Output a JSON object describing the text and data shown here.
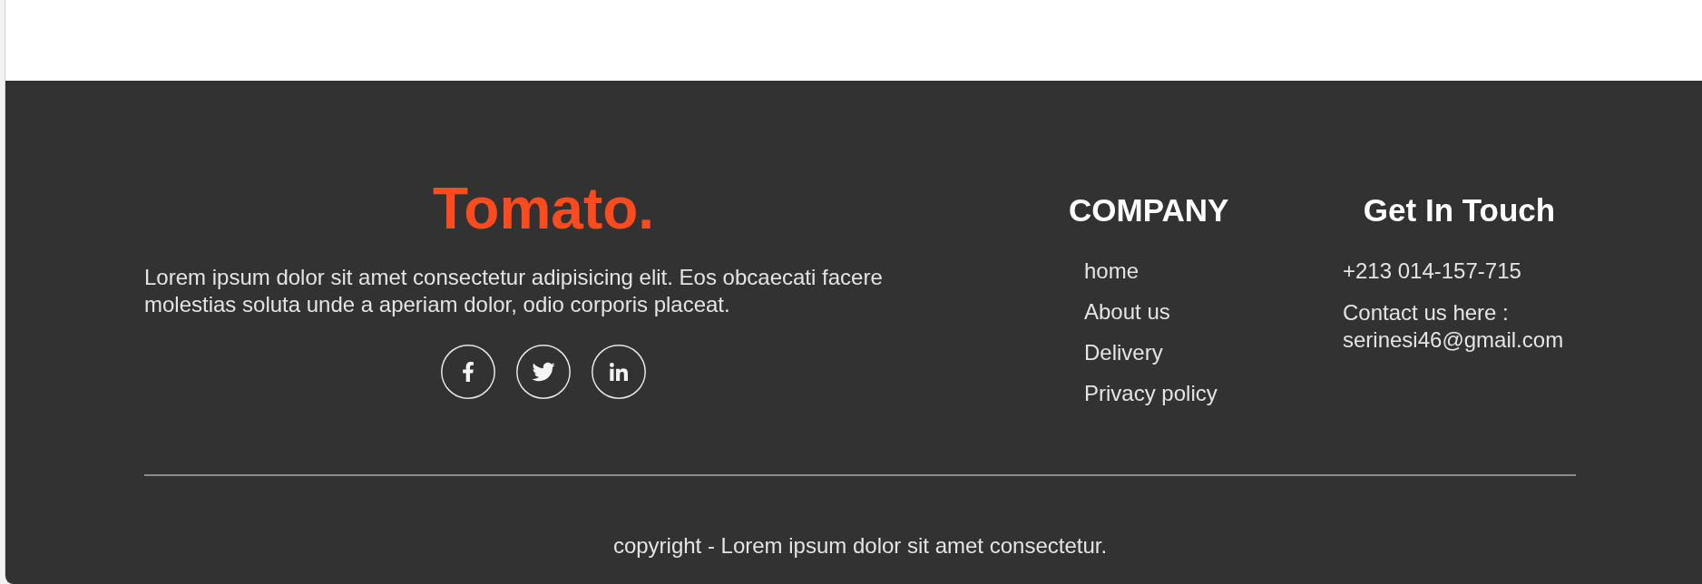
{
  "footer": {
    "logo": "Tomato.",
    "description": "Lorem ipsum dolor sit amet consectetur adipisicing elit. Eos obcaecati facere molestias soluta unde a aperiam dolor, odio corporis placeat.",
    "social_links": [
      {
        "kind": "facebook"
      },
      {
        "kind": "twitter"
      },
      {
        "kind": "linkedin"
      }
    ],
    "company": {
      "title": "COMPANY",
      "links": [
        "home",
        "About us",
        "Delivery",
        "Privacy policy"
      ]
    },
    "contact": {
      "title": "Get In Touch",
      "phone": "+213 014-157-715",
      "email_line": "Contact us here : serinesi46@gmail.com"
    },
    "copyright": "copyright - Lorem ipsum dolor sit amet consectetur."
  }
}
